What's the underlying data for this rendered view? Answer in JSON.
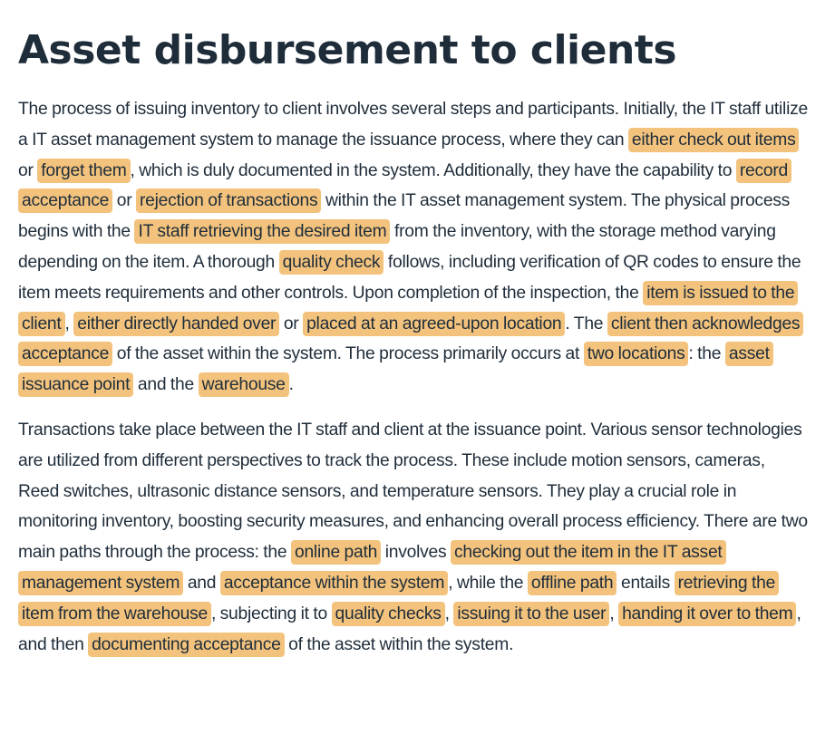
{
  "title": "Asset disbursement to clients",
  "paragraphs": [
    {
      "segments": [
        {
          "text": "The process of issuing inventory to client involves several steps and participants. Initially, the IT staff utilize a IT asset management system to manage the issuance process, where they can ",
          "hl": false
        },
        {
          "text": "either check out items",
          "hl": true
        },
        {
          "text": " or ",
          "hl": false
        },
        {
          "text": "forget them",
          "hl": true
        },
        {
          "text": ", which is duly documented in the system. Additionally, they have the capability to ",
          "hl": false
        },
        {
          "text": "record acceptance",
          "hl": true
        },
        {
          "text": " or ",
          "hl": false
        },
        {
          "text": "rejection of transactions",
          "hl": true
        },
        {
          "text": " within the IT asset management system. The physical process begins with the ",
          "hl": false
        },
        {
          "text": "IT staff retrieving the desired item",
          "hl": true
        },
        {
          "text": " from the inventory, with the storage method varying depending on the item. A thorough ",
          "hl": false
        },
        {
          "text": "quality check",
          "hl": true
        },
        {
          "text": " follows, including verification of QR codes to ensure the item meets requirements and other controls. Upon completion of the inspection, the ",
          "hl": false
        },
        {
          "text": "item is issued to the client",
          "hl": true
        },
        {
          "text": ", ",
          "hl": false
        },
        {
          "text": "either directly handed over",
          "hl": true
        },
        {
          "text": " or ",
          "hl": false
        },
        {
          "text": "placed at an agreed-upon location",
          "hl": true
        },
        {
          "text": ". The ",
          "hl": false
        },
        {
          "text": "client then acknowledges acceptance",
          "hl": true
        },
        {
          "text": " of the asset within the system. The process primarily occurs at ",
          "hl": false
        },
        {
          "text": "two locations",
          "hl": true
        },
        {
          "text": ": the ",
          "hl": false
        },
        {
          "text": "asset issuance point",
          "hl": true
        },
        {
          "text": " and the ",
          "hl": false
        },
        {
          "text": "warehouse",
          "hl": true
        },
        {
          "text": ".",
          "hl": false
        }
      ]
    },
    {
      "segments": [
        {
          "text": "Transactions take place between the IT staff and client at the issuance point. Various sensor technologies are utilized from different perspectives to track the process. These include motion sensors, cameras, Reed switches, ultrasonic distance sensors, and temperature sensors. They play a crucial role in monitoring inventory, boosting security measures, and enhancing overall process efficiency. There are two main paths through the process: the ",
          "hl": false
        },
        {
          "text": "online path",
          "hl": true
        },
        {
          "text": " involves ",
          "hl": false
        },
        {
          "text": "checking out the item in the IT asset management system",
          "hl": true
        },
        {
          "text": " and ",
          "hl": false
        },
        {
          "text": "acceptance within the system",
          "hl": true
        },
        {
          "text": ", while the ",
          "hl": false
        },
        {
          "text": "offline path",
          "hl": true
        },
        {
          "text": " entails ",
          "hl": false
        },
        {
          "text": "retrieving the item from the warehouse",
          "hl": true
        },
        {
          "text": ", subjecting it to ",
          "hl": false
        },
        {
          "text": "quality checks",
          "hl": true
        },
        {
          "text": ", ",
          "hl": false
        },
        {
          "text": "issuing it to the user",
          "hl": true
        },
        {
          "text": ", ",
          "hl": false
        },
        {
          "text": "handing it over to them",
          "hl": true
        },
        {
          "text": ", and then ",
          "hl": false
        },
        {
          "text": "documenting acceptance",
          "hl": true
        },
        {
          "text": " of the asset within the system.",
          "hl": false
        }
      ]
    }
  ],
  "colors": {
    "highlight": "#f3c37d",
    "text": "#1f2d3a",
    "background": "#ffffff"
  }
}
